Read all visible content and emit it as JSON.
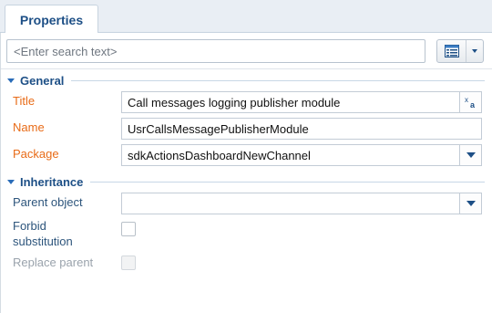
{
  "tabs": [
    {
      "label": "Properties"
    }
  ],
  "search": {
    "placeholder": "<Enter search text>"
  },
  "sections": {
    "general": {
      "title": "General"
    },
    "inheritance": {
      "title": "Inheritance"
    }
  },
  "fields": {
    "title": {
      "label": "Title",
      "value": "Call messages logging publisher module"
    },
    "name": {
      "label": "Name",
      "value": "UsrCallsMessagePublisherModule"
    },
    "package": {
      "label": "Package",
      "value": "sdkActionsDashboardNewChannel"
    },
    "parent_object": {
      "label": "Parent object",
      "value": ""
    },
    "forbid_substitution": {
      "label_line1": "Forbid",
      "label_line2": "substitution",
      "checked": false
    },
    "replace_parent": {
      "label": "Replace parent",
      "checked": false,
      "disabled": true
    }
  },
  "colors": {
    "accent": "#1d4f86",
    "required_label": "#e86b17"
  }
}
